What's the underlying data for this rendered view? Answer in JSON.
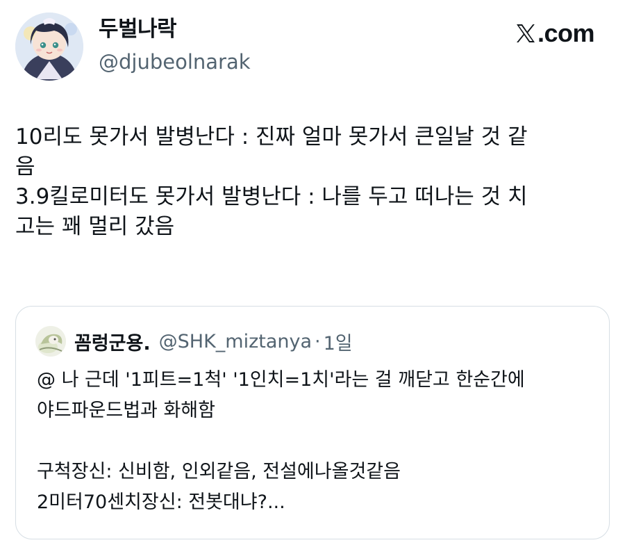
{
  "author": {
    "display_name": "두벌나락",
    "handle": "@djubeolnarak"
  },
  "brand": {
    "text": ".com",
    "icon": "x-logo-icon"
  },
  "tweet": {
    "lines": [
      "10리도 못가서 발병난다 : 진짜 얼마 못가서 큰일날 것 같",
      "음",
      "3.9킬로미터도 못가서 발병난다 : 나를 두고 떠나는 것 치",
      "고는 꽤 멀리 갔음"
    ]
  },
  "quote": {
    "display_name": "꼼렁군용.",
    "handle": "@SHK_miztanya",
    "separator": "·",
    "time": "1일",
    "lines": [
      "@ 나 근데 '1피트=1척' '1인치=1치'라는 걸 깨닫고 한순간에",
      "야드파운드법과 화해함",
      "",
      "구척장신: 신비함, 인외같음, 전설에나올것같음",
      "2미터70센치장신: 전봇대냐?..."
    ]
  },
  "colors": {
    "text": "#0f1419",
    "secondary": "#536471",
    "border": "#d6dee4"
  }
}
